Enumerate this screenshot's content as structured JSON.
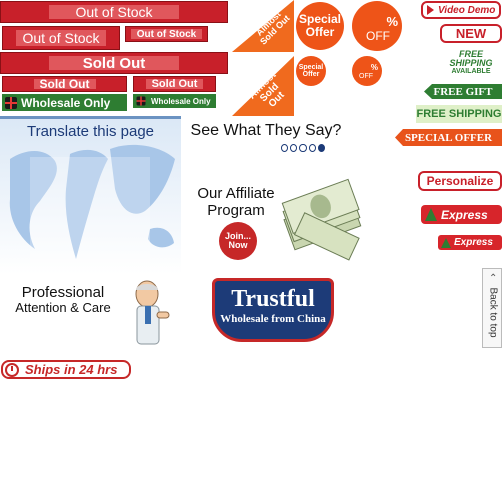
{
  "badges": {
    "out_of_stock_1": "Out of Stock",
    "out_of_stock_2": "Out of Stock",
    "out_of_stock_3": "Out of Stock",
    "sold_out_1": "Sold Out",
    "sold_out_2": "Sold Out",
    "sold_out_3": "Sold Out",
    "wholesale_1": "Wholesale Only",
    "wholesale_2": "Wholesale Only",
    "almost_sold_out_big": "Almost Sold Out",
    "almost_sold_out_small": "Almost Sold Out",
    "special_offer_big": "Special Offer",
    "special_offer_small": "Special Offer",
    "pct_off_big": "%",
    "off_big": "OFF",
    "pct_off_small": "%",
    "off_small": "OFF"
  },
  "right_column": {
    "video_demo": "Video Demo",
    "new": "NEW",
    "free_shipping_1": "FREE SHIPPING",
    "available": "AVAILABLE",
    "free_gift": "FREE GIFT",
    "free_shipping_2": "FREE SHIPPING",
    "special_offer": "SPECIAL OFFER",
    "personalize": "Personalize",
    "express_1": "Express",
    "express_2": "Express",
    "back_to_top": "Back to top"
  },
  "panels": {
    "translate": "Translate this page",
    "see_what": "See What They Say?",
    "affiliate_line1": "Our Affiliate",
    "affiliate_line2": "Program",
    "join_line1": "Join...",
    "join_line2": "Now",
    "professional_line1": "Professional",
    "professional_line2": "Attention & Care",
    "trustful_title": "Trustful",
    "trustful_sub": "Wholesale from China",
    "ships": "Ships in 24 hrs"
  },
  "carousel": {
    "dots": 5,
    "active_index": 4
  },
  "colors": {
    "red": "#c8202a",
    "orange": "#ee5418",
    "green": "#2e7d32",
    "navy": "#1d3b78"
  }
}
